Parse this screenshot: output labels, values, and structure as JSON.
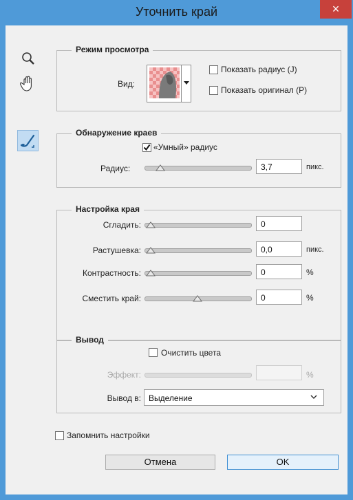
{
  "window": {
    "title": "Уточнить край",
    "close_glyph": "×"
  },
  "tools": {
    "icons": [
      "zoom-icon",
      "hand-icon",
      "refine-radius-brush-icon"
    ]
  },
  "view_mode": {
    "legend": "Режим просмотра",
    "view_label": "Вид:",
    "show_radius": {
      "label": "Показать радиус (J)",
      "checked": false
    },
    "show_original": {
      "label": "Показать оригинал (P)",
      "checked": false
    }
  },
  "edge_detection": {
    "legend": "Обнаружение краев",
    "smart_radius": {
      "label": "«Умный» радиус",
      "checked": true
    },
    "radius": {
      "label": "Радиус:",
      "value": "3,7",
      "unit": "пикс.",
      "level": 0.1
    }
  },
  "adjust_edge": {
    "legend": "Настройка края",
    "smooth": {
      "label": "Сгладить:",
      "value": "0",
      "unit": "",
      "level": 0
    },
    "feather": {
      "label": "Растушевка:",
      "value": "0,0",
      "unit": "пикс.",
      "level": 0
    },
    "contrast": {
      "label": "Контрастность:",
      "value": "0",
      "unit": "%",
      "level": 0
    },
    "shift_edge": {
      "label": "Сместить край:",
      "value": "0",
      "unit": "%",
      "level": 0.5
    }
  },
  "output": {
    "legend": "Вывод",
    "decontaminate": {
      "label": "Очистить цвета",
      "checked": false
    },
    "amount": {
      "label": "Эффект:",
      "value": "",
      "unit": "%"
    },
    "output_to": {
      "label": "Вывод в:",
      "value": "Выделение"
    }
  },
  "remember": {
    "label": "Запомнить настройки",
    "checked": false
  },
  "buttons": {
    "cancel": "Отмена",
    "ok": "OK"
  },
  "colors": {
    "title_bar": "#4f9ad8",
    "close": "#c7413b",
    "dialog_bg": "#f0f0f0",
    "selected_tool": "#c2dcf3"
  }
}
